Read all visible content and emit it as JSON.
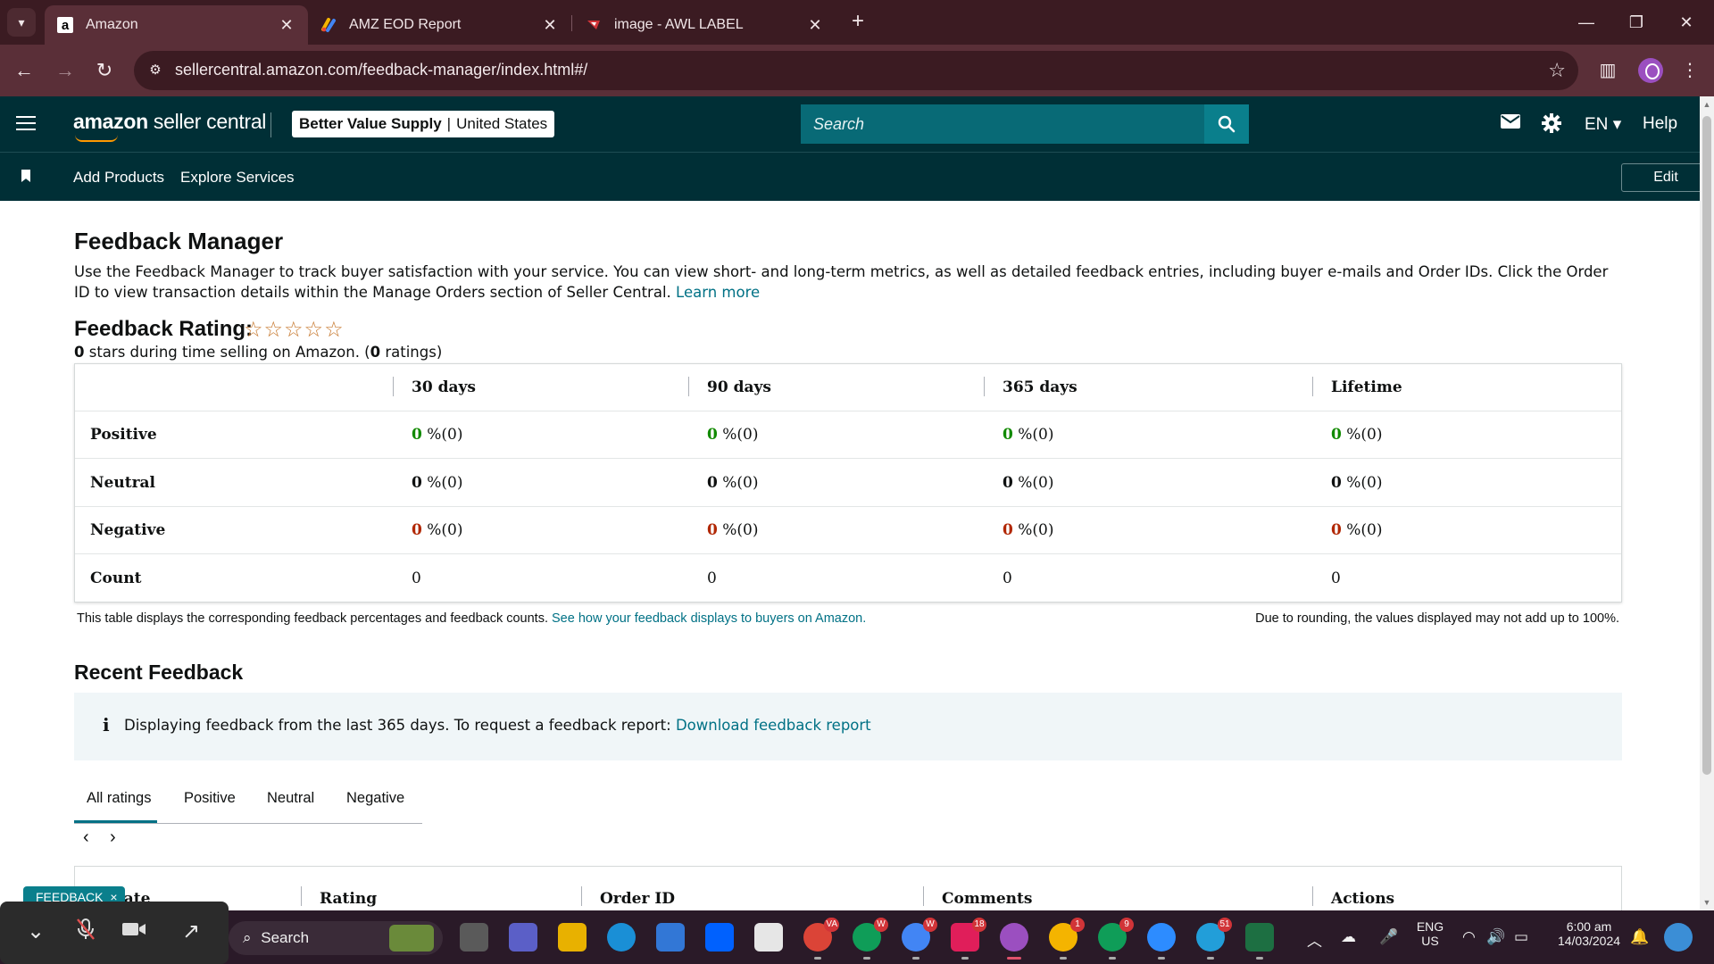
{
  "browser": {
    "tabs": [
      {
        "title": "Amazon",
        "favicon": "a",
        "active": true
      },
      {
        "title": "AMZ EOD Report",
        "favicon": "sheets-icon",
        "active": false
      },
      {
        "title": "image - AWL LABEL",
        "favicon": "label-icon",
        "active": false
      }
    ],
    "url": "sellercentral.amazon.com/feedback-manager/index.html#/"
  },
  "header": {
    "logo_brand": "amazon",
    "logo_suffix": " seller central",
    "store_name": "Better Value Supply",
    "store_separator": "|",
    "store_region": "United States",
    "search_placeholder": "Search",
    "language": "EN",
    "help": "Help"
  },
  "subnav": {
    "links": [
      "Add Products",
      "Explore Services"
    ],
    "edit": "Edit"
  },
  "page": {
    "title": "Feedback Manager",
    "intro": "Use the Feedback Manager to track buyer satisfaction with your service. You can view short- and long-term metrics, as well as detailed feedback entries, including buyer e-mails and Order IDs. Click the Order ID to view transaction details within the Manage Orders section of Seller Central.",
    "learn_more": "Learn more",
    "rating_title": "Feedback Rating:",
    "stars": "☆☆☆☆☆",
    "rating_value": "0",
    "rating_text_1": " stars during time selling on Amazon. (",
    "rating_count": "0",
    "rating_text_2": " ratings)"
  },
  "feedback_table": {
    "columns": [
      "30 days",
      "90 days",
      "365 days",
      "Lifetime"
    ],
    "rows": [
      {
        "label": "Positive",
        "kind": "pos",
        "cells": [
          {
            "n": "0",
            "s": " %(0)"
          },
          {
            "n": "0",
            "s": " %(0)"
          },
          {
            "n": "0",
            "s": " %(0)"
          },
          {
            "n": "0",
            "s": " %(0)"
          }
        ]
      },
      {
        "label": "Neutral",
        "kind": "neu",
        "cells": [
          {
            "n": "0",
            "s": " %(0)"
          },
          {
            "n": "0",
            "s": " %(0)"
          },
          {
            "n": "0",
            "s": " %(0)"
          },
          {
            "n": "0",
            "s": " %(0)"
          }
        ]
      },
      {
        "label": "Negative",
        "kind": "neg",
        "cells": [
          {
            "n": "0",
            "s": " %(0)"
          },
          {
            "n": "0",
            "s": " %(0)"
          },
          {
            "n": "0",
            "s": " %(0)"
          },
          {
            "n": "0",
            "s": " %(0)"
          }
        ]
      },
      {
        "label": "Count",
        "kind": "count",
        "cells": [
          {
            "n": "",
            "s": "0"
          },
          {
            "n": "",
            "s": "0"
          },
          {
            "n": "",
            "s": "0"
          },
          {
            "n": "",
            "s": "0"
          }
        ]
      }
    ],
    "note": "This table displays the corresponding feedback percentages and feedback counts.",
    "note_link": "See how your feedback displays to buyers on Amazon.",
    "note_right": "Due to rounding, the values displayed may not add up to 100%."
  },
  "recent": {
    "title": "Recent Feedback",
    "info_icon": "i",
    "info_text": "Displaying feedback from the last 365 days. To request a feedback report:",
    "info_link": "Download feedback report",
    "tabs": [
      "All ratings",
      "Positive",
      "Neutral",
      "Negative"
    ],
    "prev": "‹",
    "next": "›",
    "table_headers": [
      "Date",
      "Rating",
      "Order ID",
      "Comments",
      "Actions"
    ]
  },
  "widgets": {
    "feedback_tab": "FEEDBACK",
    "feedback_close": "×"
  },
  "taskbar": {
    "search": "Search",
    "lang_top": "ENG",
    "lang_bottom": "US",
    "time": "6:00 am",
    "date": "14/03/2024",
    "badges": {
      "chrome1": "VA",
      "chrome2": "W",
      "chrome3": "W",
      "slack": "18",
      "chrome5": "1",
      "chrome6": "9",
      "telegram": "51"
    }
  }
}
